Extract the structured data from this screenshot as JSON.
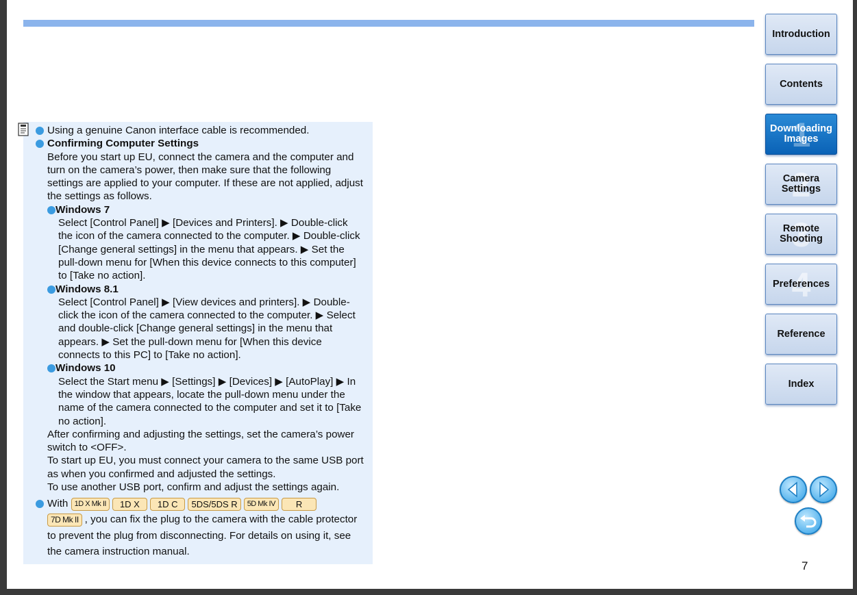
{
  "nav": {
    "introduction": "Introduction",
    "contents": "Contents",
    "downloading": [
      "Downloading",
      "Images"
    ],
    "downloading_num": "1",
    "camera": [
      "Camera",
      "Settings"
    ],
    "camera_num": "2",
    "remote": [
      "Remote",
      "Shooting"
    ],
    "remote_num": "3",
    "preferences": "Preferences",
    "preferences_num": "4",
    "reference": "Reference",
    "index": "Index"
  },
  "page_number": "7",
  "note": {
    "bullet1": "Using a genuine Canon interface cable is recommended.",
    "bullet2_title": "Confirming Computer Settings",
    "bullet2_intro": "Before you start up EU, connect the camera and the computer and turn on the camera’s power, then make sure that the following settings are applied to your computer. If these are not applied, adjust the settings as follows.",
    "win7_title": "Windows 7",
    "win7_text": "Select [Control Panel] ▶ [Devices and Printers]. ▶ Double-click the icon of the camera connected to the computer. ▶ Double-click [Change general settings] in the menu that appears. ▶ Set the pull-down menu for [When this device connects to this computer] to [Take no action].",
    "win81_title": "Windows 8.1",
    "win81_text": "Select [Control Panel] ▶ [View devices and printers]. ▶ Double-click the icon of the camera connected to the computer. ▶ Select and double-click [Change general settings] in the menu that appears. ▶ Set the pull-down menu for [When this device connects to this PC] to [Take no action].",
    "win10_title": "Windows 10",
    "win10_text": "Select the Start menu ▶ [Settings] ▶ [Devices] ▶ [AutoPlay] ▶ In the window that appears, locate the pull-down menu under the name of the camera connected to the computer and set it to [Take no action].",
    "after_confirm": "After confirming and adjusting the settings, set the camera’s power switch to <OFF>.",
    "start_eu": "To start up EU, you must connect your camera to the same USB port as when you confirmed and adjusted the settings.",
    "another_port": "To use another USB port, confirm and adjust the settings again.",
    "with_label": "With",
    "badges": [
      "1D X Mk II",
      "1D X",
      "1D C",
      "5DS/5DS R",
      "5D Mk IV",
      "R",
      "7D Mk II"
    ],
    "cable_text": ", you can fix the plug to the camera with the cable protector to prevent the plug from disconnecting. For details on using it, see the camera instruction manual."
  }
}
